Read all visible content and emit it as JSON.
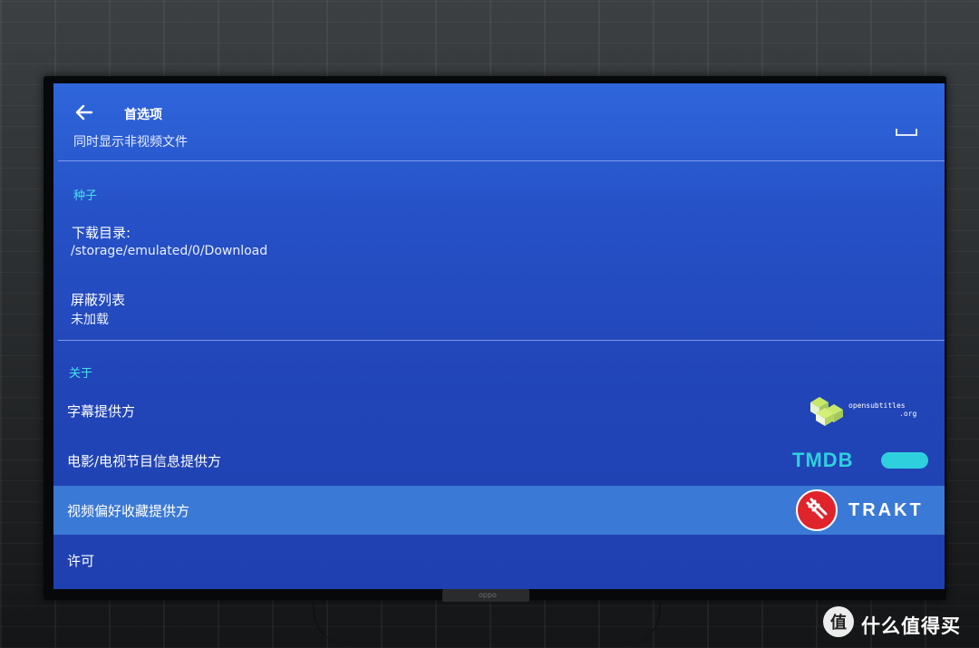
{
  "header": {
    "title": "首选项",
    "partial_item": "同时显示非视频文件"
  },
  "sections": [
    {
      "header": "种子",
      "items": [
        {
          "title": "下载目录:",
          "subtitle": "/storage/emulated/0/Download"
        },
        {
          "title": "屏蔽列表",
          "subtitle": "未加载"
        }
      ]
    },
    {
      "header": "关于",
      "items": [
        {
          "title": "字幕提供方",
          "logo": "opensubtitles"
        },
        {
          "title": "电影/电视节目信息提供方",
          "logo": "tmdb"
        },
        {
          "title": "视频偏好收藏提供方",
          "logo": "trakt",
          "selected": true
        },
        {
          "title": "许可"
        }
      ]
    }
  ],
  "logos": {
    "opensubtitles": {
      "line1": "opensubtitles",
      "line2": ".org"
    },
    "tmdb": {
      "text": "TMDB"
    },
    "trakt": {
      "text": "TRAKT"
    }
  },
  "tv": {
    "brand": "oppo"
  },
  "watermark": {
    "text": "什么值得买"
  },
  "colors": {
    "screen_bg": "#2448bf",
    "section_header": "#46e0ee",
    "selected_row": "#3b79d6",
    "tmdb": "#2fd0dd",
    "trakt": "#e0242c"
  }
}
